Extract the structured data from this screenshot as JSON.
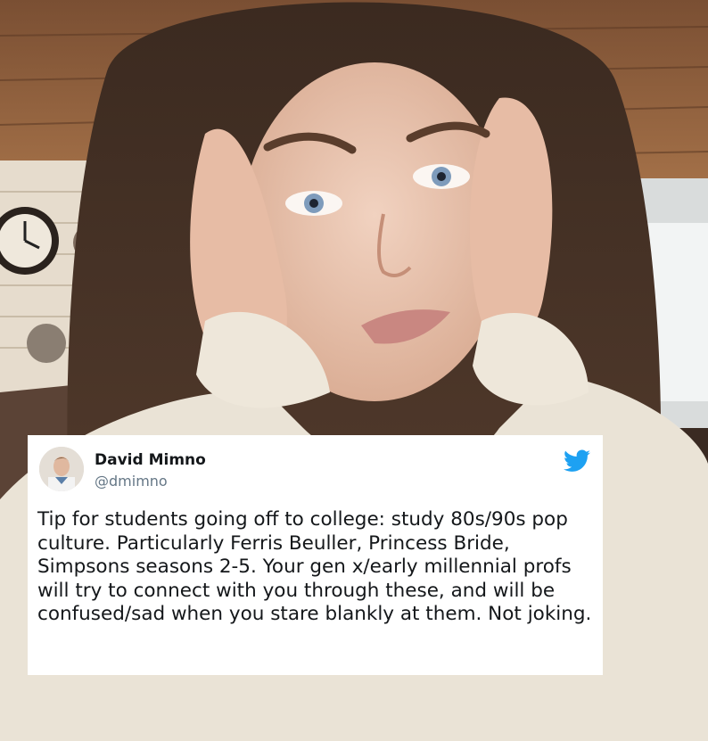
{
  "tweet": {
    "display_name": "David Mimno",
    "handle": "@dmimno",
    "text": "Tip for students going off to college: study 80s/90s pop culture. Particularly Ferris Beuller, Princess Bride, Simpsons seasons 2-5. Your gen x/early millennial profs will try to connect with you through these, and will be confused/sad when you stare blankly at them. Not joking.",
    "avatar_icon": "avatar-photo",
    "brand_icon": "twitter-bird-icon",
    "brand_color": "#1da1f2"
  }
}
